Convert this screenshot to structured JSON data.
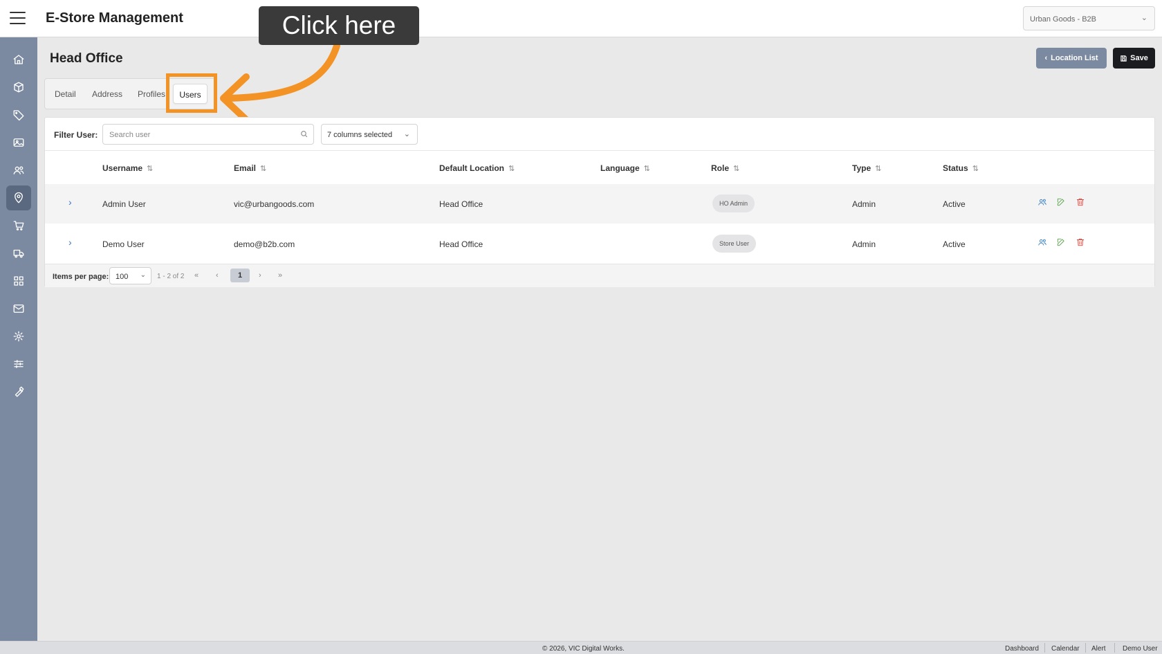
{
  "header": {
    "app_title": "E-Store Management",
    "store_selector": "Urban Goods - B2B"
  },
  "sidebar": {
    "items": [
      {
        "icon": "home-icon"
      },
      {
        "icon": "box-icon"
      },
      {
        "icon": "tag-icon"
      },
      {
        "icon": "image-icon"
      },
      {
        "icon": "users-icon"
      },
      {
        "icon": "location-pin-icon",
        "active": true
      },
      {
        "icon": "cart-icon"
      },
      {
        "icon": "truck-icon"
      },
      {
        "icon": "grid-icon"
      },
      {
        "icon": "mail-icon"
      },
      {
        "icon": "gear-icon"
      },
      {
        "icon": "sliders-icon"
      },
      {
        "icon": "wrench-icon"
      }
    ]
  },
  "page": {
    "title": "Head Office",
    "location_list_label": "Location List",
    "save_label": "Save"
  },
  "tabs": [
    {
      "label": "Detail"
    },
    {
      "label": "Address"
    },
    {
      "label": "Profiles"
    },
    {
      "label": "Users",
      "active": true
    }
  ],
  "annotation": {
    "callout_text": "Click here",
    "accent_color": "#f39325"
  },
  "filter": {
    "label": "Filter User:",
    "search_placeholder": "Search user",
    "columns_selected": "7 columns selected"
  },
  "table": {
    "columns": [
      "Username",
      "Email",
      "Default Location",
      "Language",
      "Role",
      "Type",
      "Status"
    ],
    "rows": [
      {
        "username": "Admin User",
        "email": "vic@urbangoods.com",
        "default_location": "Head Office",
        "language": "",
        "role": "HO Admin",
        "type": "Admin",
        "status": "Active"
      },
      {
        "username": "Demo User",
        "email": "demo@b2b.com",
        "default_location": "Head Office",
        "language": "",
        "role": "Store User",
        "type": "Admin",
        "status": "Active"
      }
    ]
  },
  "pagination": {
    "items_per_page_label": "Items per page:",
    "items_per_page": "100",
    "range": "1 - 2 of 2",
    "current_page": "1"
  },
  "footer": {
    "copyright": "© 2026, VIC Digital Works.",
    "links": [
      "Dashboard",
      "Calendar",
      "Alert",
      "Demo User"
    ]
  }
}
